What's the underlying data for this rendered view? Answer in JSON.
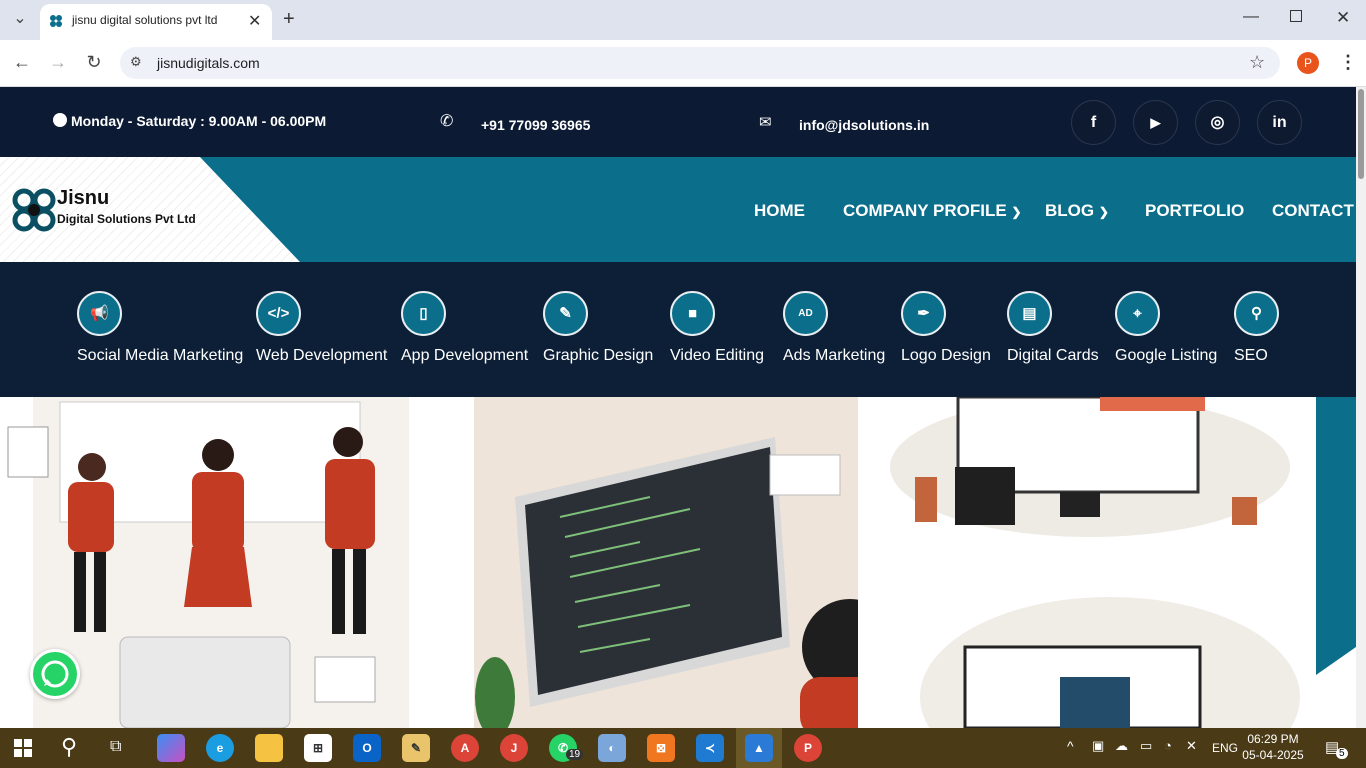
{
  "browser": {
    "tab_title": "jisnu digital solutions pvt ltd",
    "url": "jisnudigitals.com",
    "profile_initial": "P"
  },
  "topbar": {
    "hours": "Monday - Saturday : 9.00AM - 06.00PM",
    "phone": "+91 77099 36965",
    "email": "info@jdsolutions.in",
    "social": [
      "f",
      "▶",
      "◎",
      "in"
    ]
  },
  "logo": {
    "name": "Jisnu",
    "sub": "Digital Solutions Pvt Ltd"
  },
  "nav": [
    {
      "label": "HOME"
    },
    {
      "label": "COMPANY PROFILE"
    },
    {
      "label": "BLOG"
    },
    {
      "label": "PORTFOLIO"
    },
    {
      "label": "CONTACT"
    }
  ],
  "services": [
    {
      "label": "Social Media Marketing",
      "icon": "megaphone-icon"
    },
    {
      "label": "Web Development",
      "icon": "code-icon"
    },
    {
      "label": "App Development",
      "icon": "mobile-icon"
    },
    {
      "label": "Graphic Design",
      "icon": "brush-icon"
    },
    {
      "label": "Video Editing",
      "icon": "video-icon"
    },
    {
      "label": "Ads Marketing",
      "icon": "ad-icon"
    },
    {
      "label": "Logo Design",
      "icon": "pen-icon"
    },
    {
      "label": "Digital Cards",
      "icon": "card-icon"
    },
    {
      "label": "Google Listing",
      "icon": "map-icon"
    },
    {
      "label": "SEO",
      "icon": "search-icon"
    }
  ],
  "taskbar": {
    "lang": "ENG",
    "time": "06:29 PM",
    "date": "05-04-2025",
    "whatsapp_badge": "19",
    "notification_count": "5"
  },
  "colors": {
    "topbar": "#0c1a33",
    "header": "#0b6e8a",
    "services_bg": "#0c1f36"
  }
}
